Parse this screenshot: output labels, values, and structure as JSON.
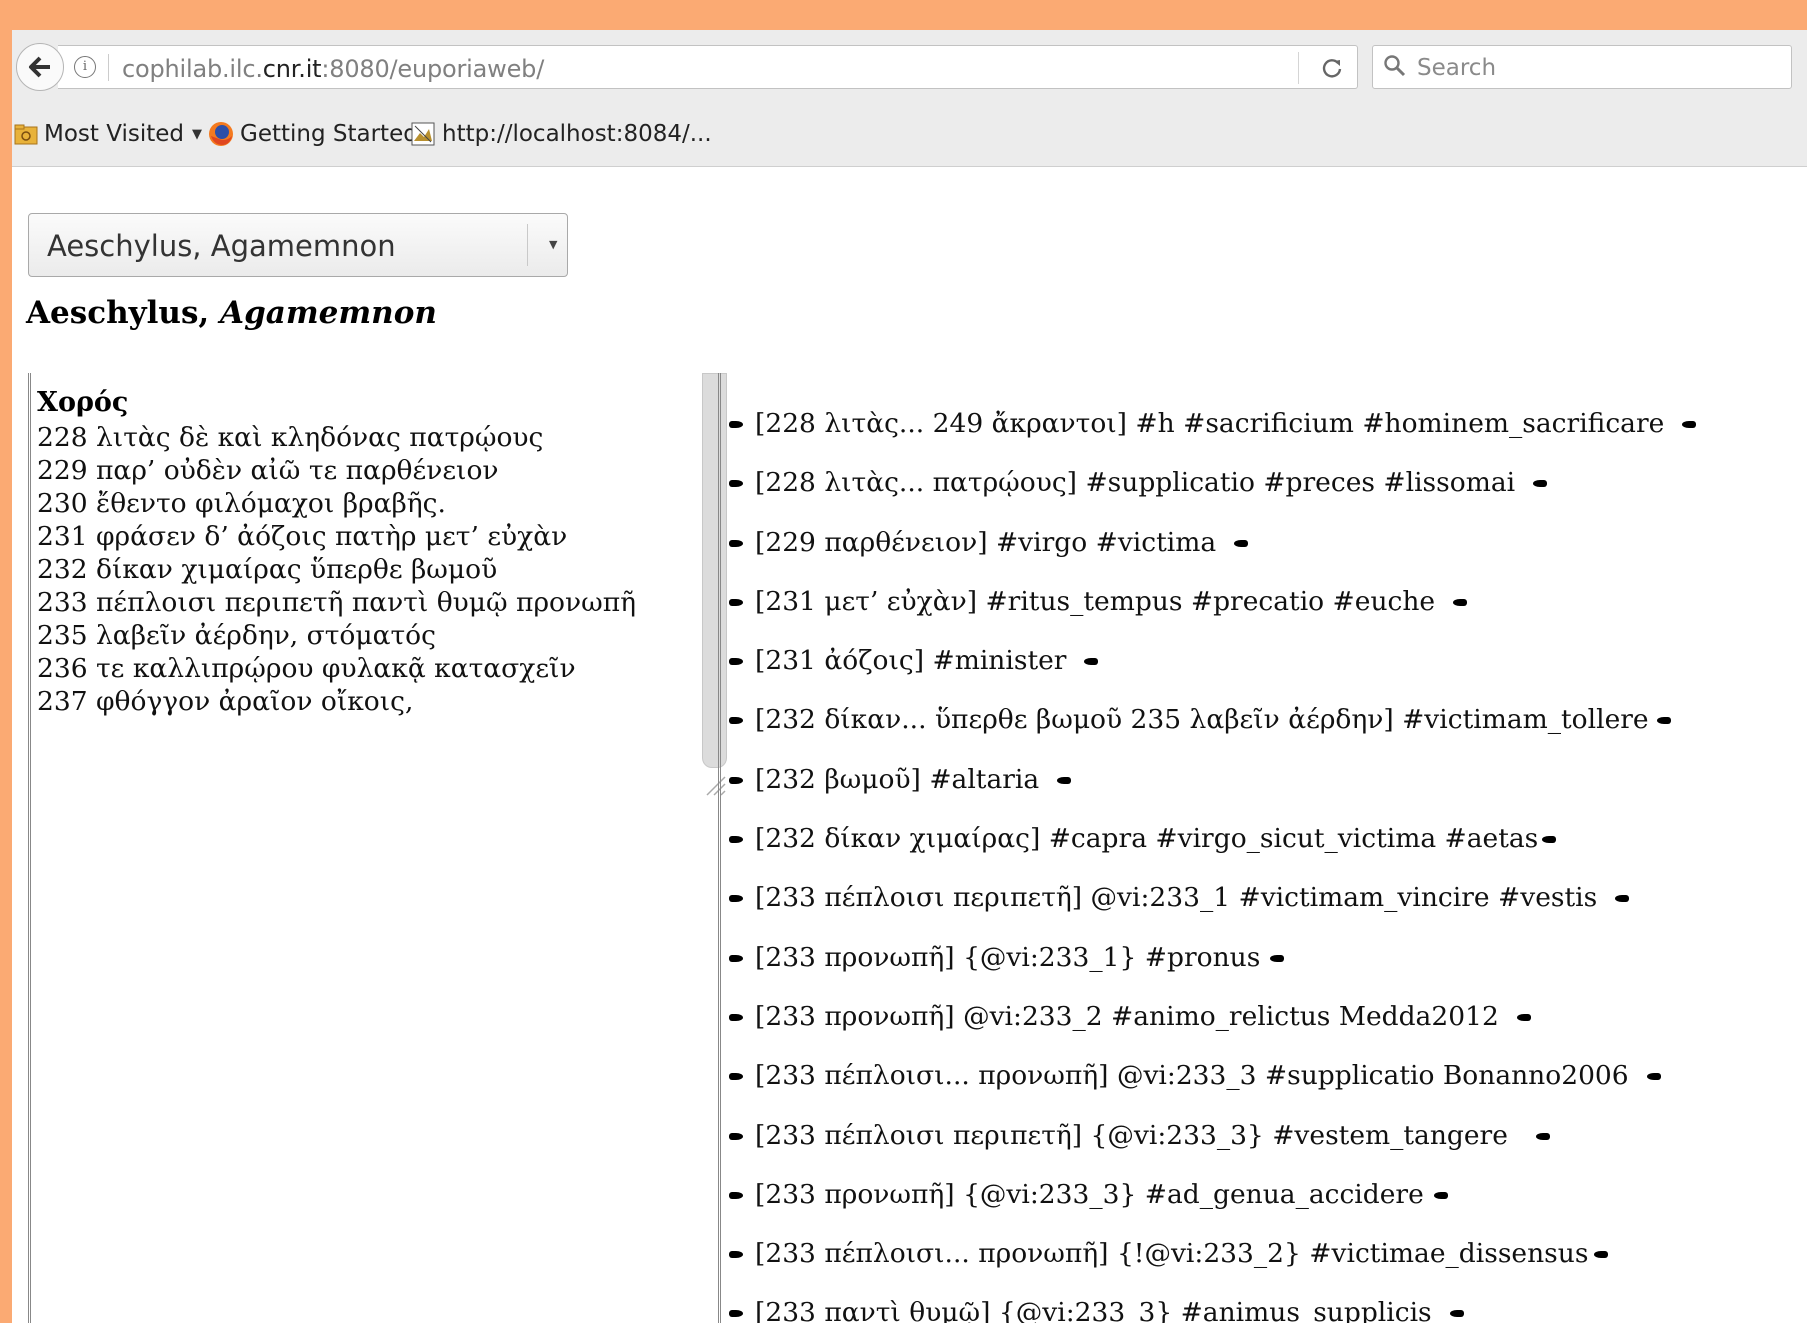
{
  "browser": {
    "url_prefix": "cophilab.ilc.",
    "url_host": "cnr.it",
    "url_suffix": ":8080/euporiaweb/",
    "search_placeholder": "Search"
  },
  "bookmarks": [
    {
      "label": "Most Visited"
    },
    {
      "label": "Getting Started"
    },
    {
      "label": "http://localhost:8084/..."
    }
  ],
  "page": {
    "select_value": "Aeschylus, Agamemnon",
    "title_author": "Aeschylus,",
    "title_work": "Agamemnon",
    "speaker": "Χορός",
    "lines": [
      "228 λιτὰς δὲ καὶ κληδόνας πατρῴους",
      "229 παρ’ οὐδὲν αἰῶ τε παρθένειον",
      "230 ἔθεντο φιλόμαχοι βραβῆς.",
      "231 φράσεν δ’ ἀόζοις πατὴρ μετ’ εὐχὰν",
      "232 δίκαν χιμαίρας ὕπερθε βωμοῦ",
      "233 πέπλοισι περιπετῆ παντὶ θυμῷ προνωπῆ",
      "235 λαβεῖν ἀέρδην, στόματός",
      "236 τε καλλιπρῴρου φυλακᾷ κατασχεῖν",
      "237 φθόγγον ἀραῖον οἴκοις,"
    ],
    "annotations": [
      "[228 λιτὰς... 249 ἄκραντοι] #h #sacrificium #hominem_sacrificare",
      "[228 λιτὰς... πατρῴους] #supplicatio #preces #lissomai",
      "[229 παρθένειον] #virgo #victima",
      "[231 μετ’ εὐχὰν] #ritus_tempus #precatio #euche",
      "[231 ἀόζοις] #minister",
      "[232 δίκαν... ὕπερθε βωμοῦ 235 λαβεῖν ἀέρδην] #victimam_tollere",
      "[232 βωμοῦ] #altaria",
      "[232 δίκαν χιμαίρας] #capra #virgo_sicut_victima #aetas",
      "[233 πέπλοισι περιπετῆ] @vi:233_1 #victimam_vincire #vestis",
      "[233 προνωπῆ] {@vi:233_1} #pronus",
      "[233 προνωπῆ] @vi:233_2 #animo_relictus Medda2012",
      "[233 πέπλοισι... προνωπῆ] @vi:233_3 #supplicatio Bonanno2006",
      "[233 πέπλοισι περιπετῆ] {@vi:233_3} #vestem_tangere",
      "[233 προνωπῆ]  {@vi:233_3} #ad_genua_accidere",
      "[233 πέπλοισι... προνωπῆ] {!@vi:233_2}  #victimae_dissensus",
      "[233 παντὶ θυμῷ] {@vi:233_3} #animus_supplicis"
    ]
  },
  "icons": {
    "back": "back-arrow-icon",
    "info": "info-icon",
    "reload": "reload-icon",
    "search": "search-icon",
    "bookmark_folder": "bookmark-folder-icon",
    "firefox": "firefox-icon",
    "page": "page-icon",
    "hand": "pointing-hand-icon"
  },
  "colors": {
    "window_border": "#fbaa73",
    "chrome_bg": "#ececec"
  }
}
